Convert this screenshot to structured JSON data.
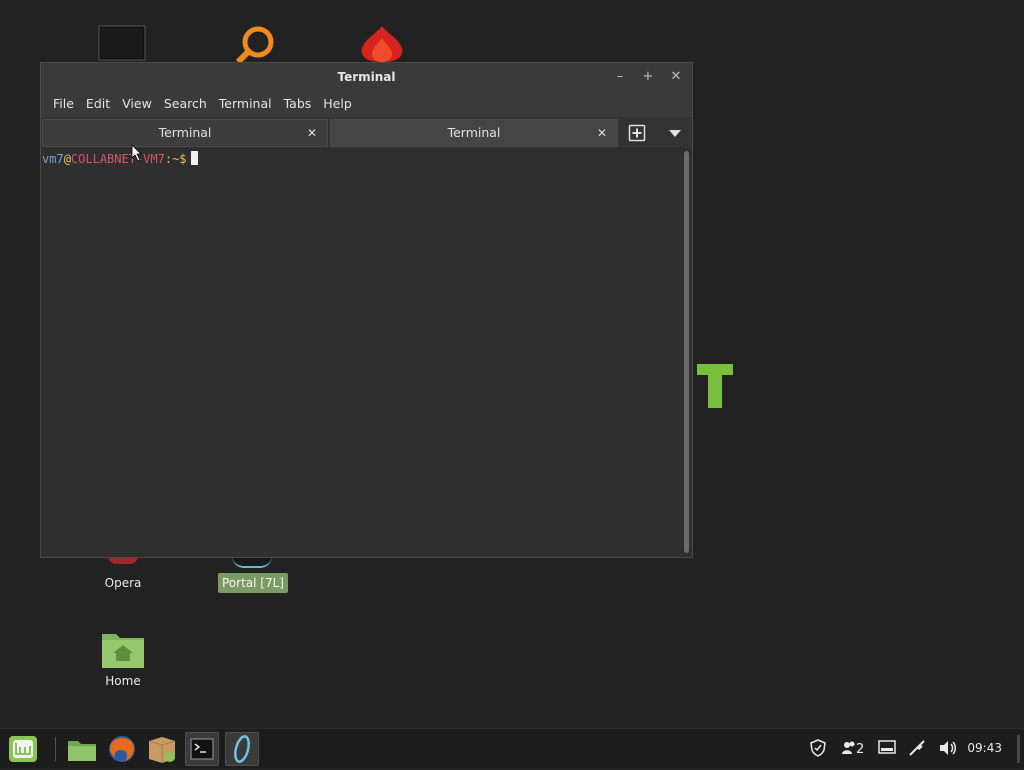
{
  "window": {
    "title": "Terminal",
    "menu": [
      "File",
      "Edit",
      "View",
      "Search",
      "Terminal",
      "Tabs",
      "Help"
    ],
    "tabs": [
      {
        "label": "Terminal",
        "active": false
      },
      {
        "label": "Terminal",
        "active": true
      }
    ],
    "prompt": {
      "user": "vm7",
      "at": "@",
      "host": "COLLABNET-VM7",
      "sep": ":",
      "path": "~$"
    }
  },
  "desktop": {
    "icons": [
      {
        "label": "Opera",
        "icon": "opera-icon"
      },
      {
        "label": "Portal [7L]",
        "icon": "portal-icon",
        "selected": true
      },
      {
        "label": "Home",
        "icon": "home-folder-icon"
      }
    ]
  },
  "taskbar": {
    "clock": "09:43",
    "notification_count": "2"
  },
  "colors": {
    "prompt_user": "#7b9fd8",
    "prompt_host": "#d5576d",
    "prompt_path": "#e6c15b",
    "selection": "#7a9b62",
    "mint_green": "#8dc45a"
  }
}
